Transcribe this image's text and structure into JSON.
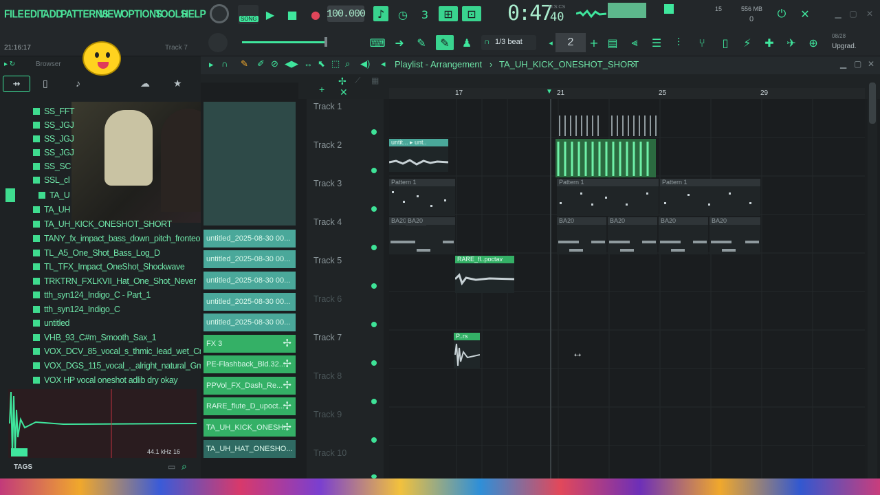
{
  "menus": [
    "FILE",
    "EDIT",
    "ADD",
    "PATTERNS",
    "VIEW",
    "OPTIONS",
    "TOOLS",
    "HELP"
  ],
  "transport": {
    "mode": "SONG",
    "tempo": "100.000",
    "time": "0:47",
    "time_sub": "40",
    "time_unit": "M:S:CS",
    "cpu_mem": "556 MB",
    "cpu_num": "15",
    "voices": "0"
  },
  "hint": {
    "clock": "21:16:17",
    "track": "Track 7"
  },
  "toolbar2": {
    "snap": "1/3 beat",
    "step_value": "2",
    "update": "Upgrad.",
    "update_date": "08/28"
  },
  "browser": {
    "title": "Browser",
    "items": [
      "SS_FFT",
      "SS_JGJ",
      "SS_JGJ",
      "SS_JGJ",
      "SS_SC",
      "SSL_cl",
      "TA_U",
      "TA_UH",
      "TA_UH_KICK_ONESHOT_SHORT",
      "TANY_fx_impact_bass_down_pitch_fronteo",
      "TL_A5_One_Shot_Bass_Log_D",
      "TL_TFX_Impact_OneShot_Shockwave",
      "TRKTRN_FXLKVII_Hat_One_Shot_Never",
      "tth_syn124_Indigo_C - Part_1",
      "tth_syn124_Indigo_C",
      "untitled",
      "VHB_93_C#m_Smooth_Sax_1",
      "VOX_DCV_85_vocal_s_thmic_lead_wet_Cmin",
      "VOX_DGS_115_vocal_._alright_natural_Gm",
      "VOX HP vocal oneshot adlib dry okay"
    ],
    "sample_rate": "44.1",
    "bitdepth": "kHz 16",
    "tags_label": "TAGS"
  },
  "picker": {
    "items": [
      {
        "label": "untitled_2025-08-30 00...",
        "kind": "audio"
      },
      {
        "label": "untitled_2025-08-30 00...",
        "kind": "audio"
      },
      {
        "label": "untitled_2025-08-30 00...",
        "kind": "audio"
      },
      {
        "label": "untitled_2025-08-30 00...",
        "kind": "audio"
      },
      {
        "label": "untitled_2025-08-30 00...",
        "kind": "audio"
      },
      {
        "label": "FX 3",
        "kind": "pat"
      },
      {
        "label": "PE-Flashback_Bld.32...",
        "kind": "pat"
      },
      {
        "label": "PPVol_FX_Dash_Re...",
        "kind": "pat"
      },
      {
        "label": "RARE_flute_D_upoct...",
        "kind": "pat"
      },
      {
        "label": "TA_UH_KICK_ONESH...",
        "kind": "pat"
      },
      {
        "label": "TA_UH_HAT_ONESHO...",
        "kind": "audio"
      }
    ]
  },
  "playlist": {
    "title": "Playlist - Arrangement",
    "crumb": "TA_UH_KICK_ONESHOT_SHORT",
    "ruler": [
      "17",
      "21",
      "25",
      "29"
    ],
    "tracks": [
      "Track 1",
      "Track 2",
      "Track 3",
      "Track 4",
      "Track 5",
      "Track 6",
      "Track 7",
      "Track 8",
      "Track 9",
      "Track 10"
    ],
    "clips": {
      "t2a": "untit... ▸ unt..",
      "t3a": "Pattern 1",
      "t3b": "Pattern 1",
      "t3c": "Pattern 1",
      "t4a": "BA20",
      "t4b": "BA20",
      "t4c": "BA20",
      "t4d": "BA20",
      "t4e": "BA20",
      "t4f": "BA20",
      "t5": "RARE_fl..poctav",
      "t7": "P..rs"
    }
  },
  "colors": {
    "accent": "#3fe69d",
    "bg": "#1b1e20"
  }
}
